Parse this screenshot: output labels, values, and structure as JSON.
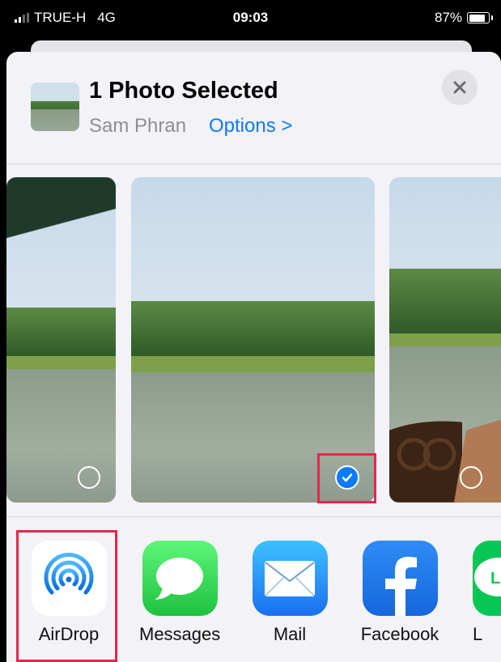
{
  "status_bar": {
    "carrier": "TRUE-H",
    "network": "4G",
    "time": "09:03",
    "battery": "87%"
  },
  "header": {
    "title": "1 Photo Selected",
    "album": "Sam Phran",
    "options_label": "Options >"
  },
  "photos": [
    {
      "selected": false
    },
    {
      "selected": true
    },
    {
      "selected": false
    }
  ],
  "apps": [
    {
      "label": "AirDrop",
      "icon": "airdrop-icon"
    },
    {
      "label": "Messages",
      "icon": "messages-icon"
    },
    {
      "label": "Mail",
      "icon": "mail-icon"
    },
    {
      "label": "Facebook",
      "icon": "facebook-icon"
    },
    {
      "label": "L",
      "icon": "line-icon"
    }
  ],
  "colors": {
    "accent": "#0a7aff",
    "highlight": "#e8264a",
    "messages": "#34c759",
    "mail": "#1e88f5",
    "facebook": "#1877f2",
    "line": "#06c755"
  }
}
